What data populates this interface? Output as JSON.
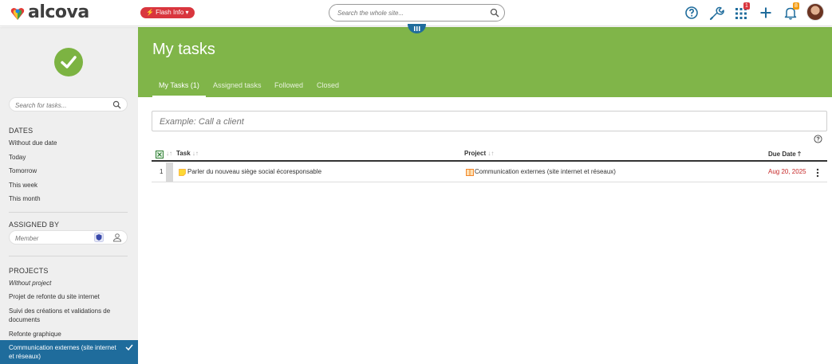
{
  "brand": {
    "name": "alcova"
  },
  "topbar": {
    "flash_label": "⚡ Flash Info ▾",
    "search_placeholder": "Search the whole site...",
    "apps_badge": "1",
    "notifications_badge": "8"
  },
  "sidebar": {
    "search_placeholder": "Search for tasks...",
    "dates": {
      "title": "DATES",
      "items": [
        "Without due date",
        "Today",
        "Tomorrow",
        "This week",
        "This month"
      ]
    },
    "assigned_by": {
      "title": "ASSIGNED BY",
      "member_placeholder": "Member"
    },
    "projects": {
      "title": "PROJECTS",
      "items": [
        "Without project",
        "Projet de refonte du site internet",
        "Suivi des créations et validations de documents",
        "Refonte graphique",
        "Communication externes (site internet et réseaux)"
      ],
      "active_index": 4
    }
  },
  "main": {
    "title": "My tasks",
    "tabs": [
      {
        "label": "My Tasks (1)",
        "active": true
      },
      {
        "label": "Assigned tasks",
        "active": false
      },
      {
        "label": "Followed",
        "active": false
      },
      {
        "label": "Closed",
        "active": false
      }
    ],
    "new_task_placeholder": "Example: Call a client",
    "table": {
      "columns": {
        "task": "Task",
        "project": "Project",
        "due": "Due Date"
      },
      "rows": [
        {
          "num": "1",
          "task": "Parler du nouveau siège social écoresponsable",
          "project": "Communication externes (site internet et réseaux)",
          "due": "Aug 20, 2025"
        }
      ]
    }
  },
  "colors": {
    "header_green": "#80b549",
    "accent_blue": "#1f6c9c",
    "flash_red": "#d9363e",
    "due_red": "#c62828"
  }
}
